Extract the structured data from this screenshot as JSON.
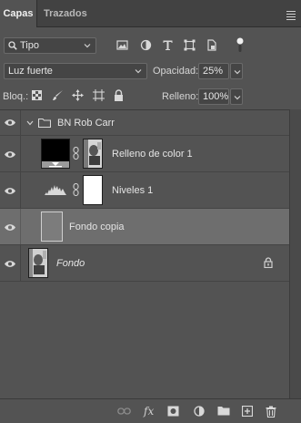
{
  "tabs": [
    {
      "label": "Capas",
      "active": true
    },
    {
      "label": "Trazados",
      "active": false
    }
  ],
  "filter": {
    "kind_label": "Tipo",
    "icons": [
      "image-filter-icon",
      "adjustment-filter-icon",
      "type-filter-icon",
      "shape-filter-icon",
      "smart-object-filter-icon"
    ]
  },
  "blend": {
    "mode": "Luz fuerte",
    "opacity_label": "Opacidad:",
    "opacity_value": "25%"
  },
  "lock": {
    "label": "Bloq.:",
    "icons": [
      "lock-transparency-icon",
      "lock-paint-icon",
      "lock-position-icon",
      "lock-artboard-icon",
      "lock-all-icon"
    ],
    "fill_label": "Relleno:",
    "fill_value": "100%"
  },
  "layers": [
    {
      "name": "BN Rob Carr",
      "type": "group",
      "expanded": true,
      "visible": true,
      "selected": false
    },
    {
      "name": "Relleno de color 1",
      "type": "fill-with-mask",
      "visible": true,
      "selected": false
    },
    {
      "name": "Niveles 1",
      "type": "adjustment-levels",
      "visible": true,
      "selected": false
    },
    {
      "name": "Fondo copia",
      "type": "pixel",
      "visible": true,
      "selected": true
    },
    {
      "name": "Fondo",
      "type": "background",
      "visible": true,
      "selected": false,
      "locked": true
    }
  ],
  "footer_icons": [
    "link-layers-icon",
    "fx-icon",
    "add-mask-icon",
    "new-adjustment-icon",
    "new-group-icon",
    "new-layer-icon",
    "delete-layer-icon"
  ],
  "footer_fx_label": "fx"
}
